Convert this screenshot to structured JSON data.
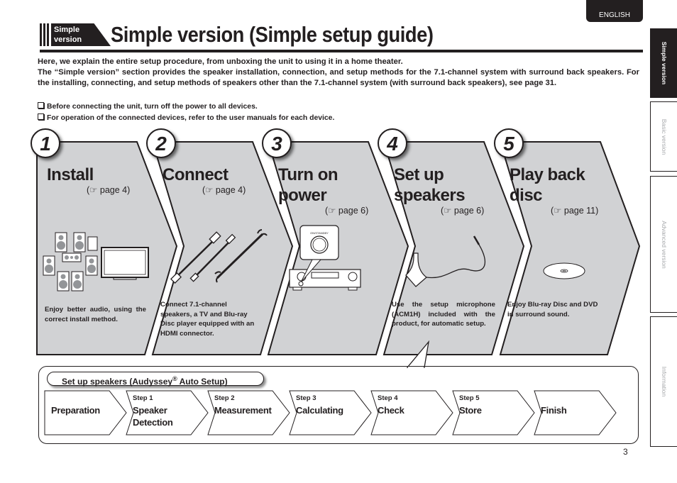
{
  "language_tab": "ENGLISH",
  "side_tabs": [
    {
      "label": "Simple version",
      "active": true
    },
    {
      "label": "Basic version",
      "active": false
    },
    {
      "label": "Advanced version",
      "active": false
    },
    {
      "label": "Information",
      "active": false
    }
  ],
  "header": {
    "badge": [
      "Simple",
      "version"
    ],
    "title": "Simple version (Simple setup guide)"
  },
  "intro": {
    "paragraph1": "Here, we explain the entire setup procedure, from unboxing the unit to using it in a home theater.",
    "paragraph2": "The “Simple version” section provides the speaker installation, connection, and setup methods for the 7.1-channel system with surround back speakers. For the installing, connecting, and setup methods of speakers other than the 7.1-channel system (with surround back speakers), see page 31.",
    "notes": [
      "Before connecting the unit, turn off the power to all devices.",
      "For operation of the connected devices, refer to the user manuals for each device."
    ]
  },
  "steps": [
    {
      "number": "1",
      "title": [
        "Install"
      ],
      "ref": "page 4",
      "ref_icon": "pointing-hand-icon",
      "description": "Enjoy better audio, using the correct install method.",
      "illustration": "speaker-layout-illustration"
    },
    {
      "number": "2",
      "title": [
        "Connect"
      ],
      "ref": "page 4",
      "ref_icon": "pointing-hand-icon",
      "description": "Connect 7.1-channel speakers, a TV and Blu-ray Disc player equipped with an HDMI connector.",
      "illustration": "cables-illustration"
    },
    {
      "number": "3",
      "title": [
        "Turn on",
        "power"
      ],
      "ref": "page 6",
      "ref_icon": "pointing-hand-icon",
      "description": "",
      "illustration": "receiver-power-illustration",
      "button_label": "ON/STANDBY"
    },
    {
      "number": "4",
      "title": [
        "Set up",
        "speakers"
      ],
      "ref": "page 6",
      "ref_icon": "pointing-hand-icon",
      "description": "Use the setup microphone (ACM1H) included with the product, for automatic setup.",
      "illustration": "microphone-illustration"
    },
    {
      "number": "5",
      "title": [
        "Play back",
        "disc"
      ],
      "ref": "page 11",
      "ref_icon": "pointing-hand-icon",
      "description": "Enjoy Blu-ray Disc and DVD in surround sound.",
      "illustration": "disc-illustration"
    }
  ],
  "auto_setup": {
    "title_prefix": "Set up speakers (Audyssey",
    "title_reg": "®",
    "title_suffix": " Auto Setup)",
    "flow": [
      {
        "step": "",
        "name": "Preparation"
      },
      {
        "step": "Step 1",
        "name": "Speaker Detection"
      },
      {
        "step": "Step 2",
        "name": "Measurement"
      },
      {
        "step": "Step 3",
        "name": "Calculating"
      },
      {
        "step": "Step 4",
        "name": "Check"
      },
      {
        "step": "Step 5",
        "name": "Store"
      },
      {
        "step": "",
        "name": "Finish"
      }
    ]
  },
  "page_number": "3",
  "colors": {
    "panel_fill": "#d1d2d4",
    "ink": "#231f20",
    "speaker_gray": "#939598"
  }
}
